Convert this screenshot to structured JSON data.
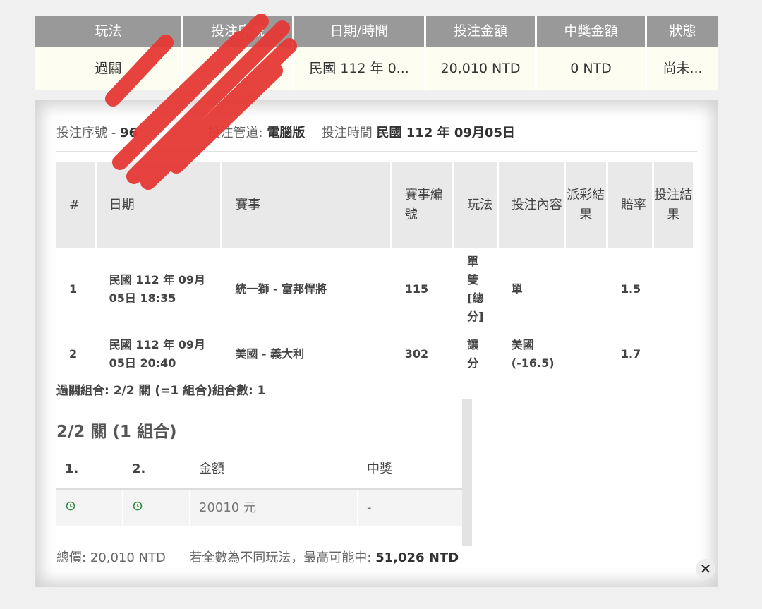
{
  "summary": {
    "headers": [
      "玩法",
      "投注序號",
      "日期/時間",
      "投注金額",
      "中獎金額",
      "狀態"
    ],
    "values": [
      "過關",
      "",
      "民國 112 年 0...",
      "20,010 NTD",
      "0 NTD",
      "尚未..."
    ]
  },
  "meta": {
    "serial_label": "投注序號",
    "serial_sep": "-",
    "serial_value": "96",
    "channel_label": "投注管道:",
    "channel_value": "電腦版",
    "time_label": "投注時間",
    "time_value": "民國 112 年 09月05日"
  },
  "legs": {
    "headers": [
      "#",
      "日期",
      "賽事",
      "賽事編號",
      "玩法",
      "投注內容",
      "派彩結果",
      "賠率",
      "投注結果"
    ],
    "rows": [
      {
        "no": "1",
        "date": "民國 112 年 09月 05日 18:35",
        "match": "統一獅 - 富邦悍將",
        "event_no": "115",
        "play": "單雙[總分]",
        "pick": "單",
        "payout": "",
        "odds": "1.5",
        "result": ""
      },
      {
        "no": "2",
        "date": "民國 112 年 09月 05日 20:40",
        "match": "美國 - 義大利",
        "event_no": "302",
        "play": "讓分",
        "pick": "美國 (-16.5)",
        "payout": "",
        "odds": "1.7",
        "result": ""
      }
    ]
  },
  "parlay_line": "過關組合: 2/2 關 (=1 組合)組合數: 1",
  "combo": {
    "title": "2/2 關 (1 組合)",
    "headers": [
      "1.",
      "2.",
      "金額",
      "中獎"
    ],
    "row": {
      "amount": "20010 元",
      "win": "-"
    }
  },
  "totals": {
    "total_label": "總價:",
    "total_value": "20,010 NTD",
    "max_label": "若全數為不同玩法，最高可能中:",
    "max_value": "51,026 NTD"
  },
  "close_label": "✕",
  "colors": {
    "header_bg": "#999999",
    "row_bg": "#fdfdf1",
    "pending_icon": "#2e8b3d",
    "scribble": "#e53935"
  }
}
